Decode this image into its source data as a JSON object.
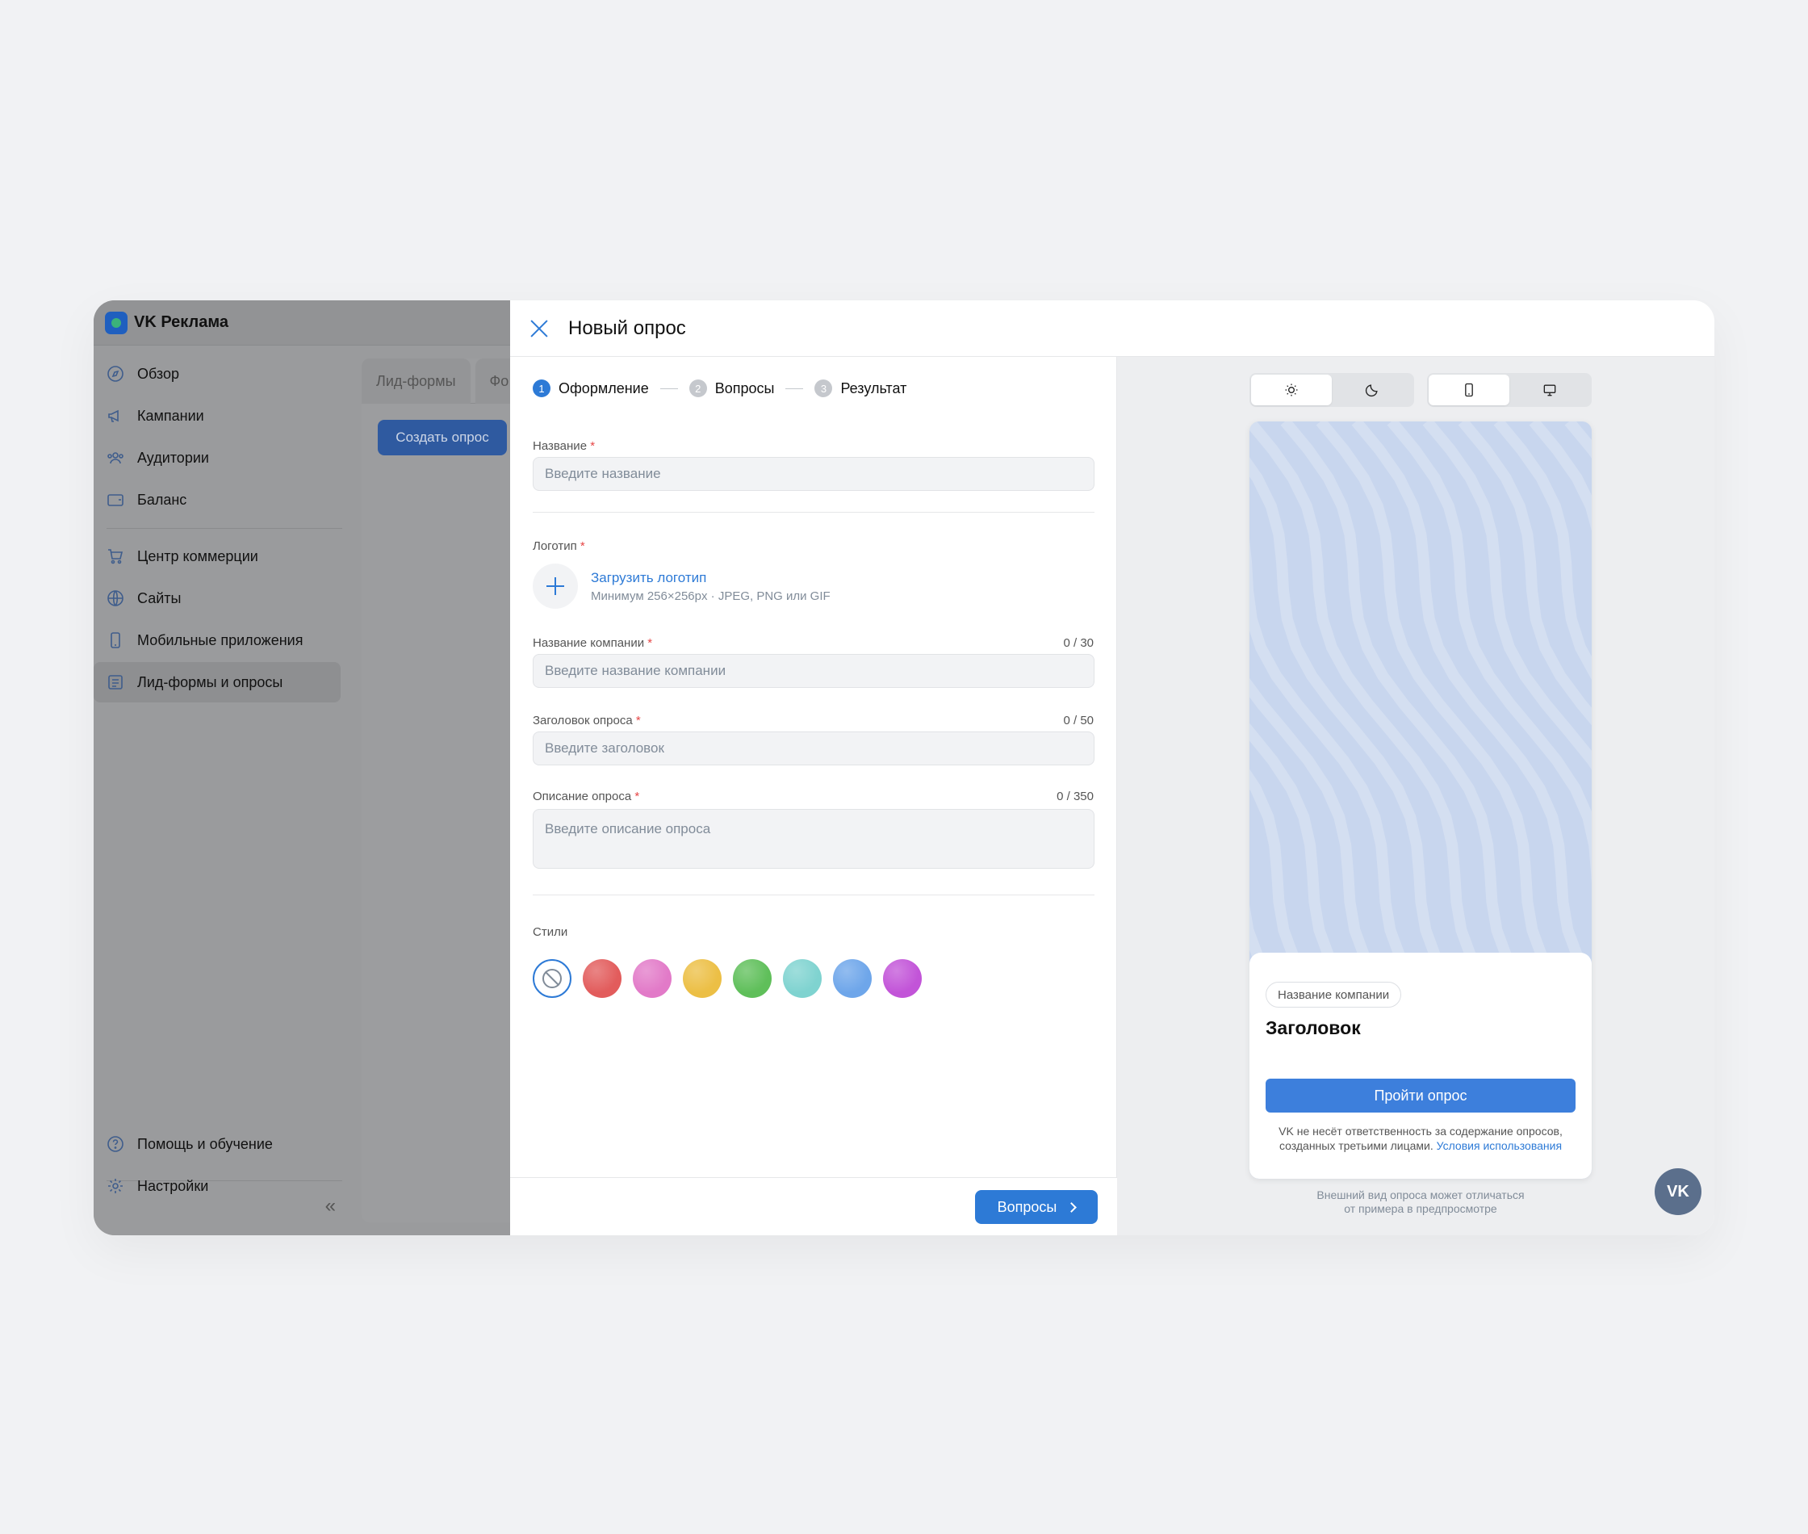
{
  "app": {
    "brand": "VK Реклама"
  },
  "sidebar": {
    "items": [
      {
        "label": "Обзор",
        "icon": "compass-icon"
      },
      {
        "label": "Кампании",
        "icon": "megaphone-icon"
      },
      {
        "label": "Аудитории",
        "icon": "users-icon"
      },
      {
        "label": "Баланс",
        "icon": "wallet-icon"
      },
      {
        "label": "Центр коммерции",
        "icon": "cart-icon"
      },
      {
        "label": "Сайты",
        "icon": "globe-icon"
      },
      {
        "label": "Мобильные приложения",
        "icon": "phone-icon"
      },
      {
        "label": "Лид-формы и опросы",
        "icon": "list-icon",
        "active": true
      }
    ],
    "bottom": [
      {
        "label": "Помощь и обучение",
        "icon": "help-icon"
      },
      {
        "label": "Настройки",
        "icon": "gear-icon"
      }
    ]
  },
  "background": {
    "tabs": [
      "Лид-формы",
      "Фо"
    ],
    "create_button": "Создать опрос"
  },
  "modal": {
    "title": "Новый опрос",
    "steps": [
      {
        "num": "1",
        "label": "Оформление",
        "active": true
      },
      {
        "num": "2",
        "label": "Вопросы",
        "active": false
      },
      {
        "num": "3",
        "label": "Результат",
        "active": false
      }
    ],
    "fields": {
      "name": {
        "label": "Название",
        "placeholder": "Введите название"
      },
      "logo": {
        "label": "Логотип",
        "link": "Загрузить логотип",
        "hint": "Минимум 256×256px · JPEG, PNG или GIF"
      },
      "company": {
        "label": "Название компании",
        "counter": "0 / 30",
        "placeholder": "Введите название компании"
      },
      "heading": {
        "label": "Заголовок опроса",
        "counter": "0 / 50",
        "placeholder": "Введите заголовок"
      },
      "description": {
        "label": "Описание опроса",
        "counter": "0 / 350",
        "placeholder": "Введите описание опроса"
      }
    },
    "styles": {
      "label": "Стили",
      "colors": [
        "none",
        "#e25c5c",
        "#e27ac8",
        "#ecbf45",
        "#5fbf5a",
        "#7fd3d0",
        "#6ea6ea",
        "#c254d8"
      ]
    },
    "next_button": "Вопросы"
  },
  "preview": {
    "theme_toggle": [
      "sun-icon",
      "moon-icon"
    ],
    "device_toggle": [
      "phone-icon",
      "desktop-icon"
    ],
    "card": {
      "chip": "Название компании",
      "title": "Заголовок",
      "button": "Пройти опрос",
      "disclaimer": "VK не несёт ответственность за содержание опросов, созданных третьими лицами.",
      "terms_link": "Условия использования"
    },
    "note_line1": "Внешний вид опроса может отличаться",
    "note_line2": "от примера в предпросмотре",
    "fab": "VK"
  },
  "colors": {
    "accent": "#2d7ad6",
    "required": "#e64646"
  }
}
